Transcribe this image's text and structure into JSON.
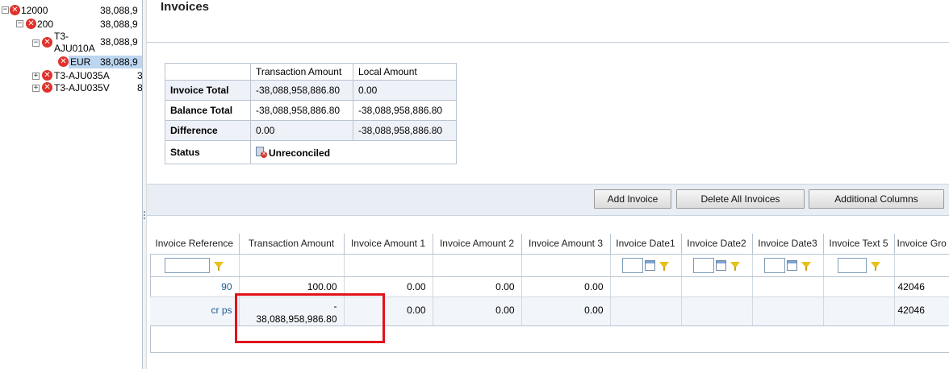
{
  "tree": {
    "nodes": [
      {
        "label": "12000",
        "value": "38,088,9",
        "toggle": "−"
      },
      {
        "label": "200",
        "value": "38,088,9",
        "toggle": "−"
      },
      {
        "label_line1": "T3-",
        "label_line2": "AJU010A",
        "value": "38,088,9",
        "toggle": "−"
      },
      {
        "label": "EUR",
        "value": "38,088,9"
      },
      {
        "label": "T3-AJU035A",
        "value": "3",
        "toggle": "+"
      },
      {
        "label": "T3-AJU035V",
        "value": "8",
        "toggle": "+"
      }
    ]
  },
  "page": {
    "title": "Invoices"
  },
  "summary": {
    "headers": [
      "Transaction Amount",
      "Local Amount"
    ],
    "rows": [
      {
        "label": "Invoice Total",
        "transaction": "-38,088,958,886.80",
        "local": "0.00"
      },
      {
        "label": "Balance Total",
        "transaction": "-38,088,958,886.80",
        "local": "-38,088,958,886.80"
      },
      {
        "label": "Difference",
        "transaction": "0.00",
        "local": "-38,088,958,886.80"
      }
    ],
    "status_label": "Status",
    "status_value": "Unreconciled"
  },
  "buttons": {
    "add_invoice": "Add Invoice",
    "delete_all": "Delete All Invoices",
    "additional_columns": "Additional Columns"
  },
  "grid": {
    "columns": [
      "Invoice Reference",
      "Transaction Amount",
      "Invoice Amount 1",
      "Invoice Amount 2",
      "Invoice Amount 3",
      "Invoice Date1",
      "Invoice Date2",
      "Invoice Date3",
      "Invoice Text 5",
      "Invoice Gro"
    ],
    "rows": [
      {
        "reference": "90",
        "transaction": "100.00",
        "amount1": "0.00",
        "amount2": "0.00",
        "amount3": "0.00",
        "group": "42046"
      },
      {
        "reference": "cr ps",
        "transaction_sign": "-",
        "transaction": "38,088,958,986.80",
        "amount1": "0.00",
        "amount2": "0.00",
        "amount3": "0.00",
        "group": "42046"
      }
    ]
  },
  "colors": {
    "highlight": "#e0131b",
    "error": "#e0322b",
    "link": "#1b5a93"
  }
}
